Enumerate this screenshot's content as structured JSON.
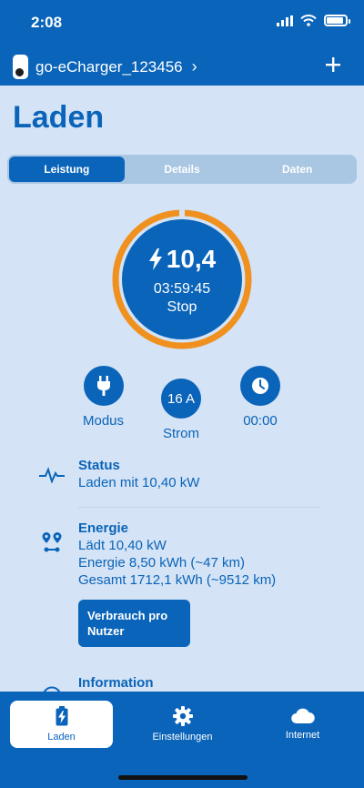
{
  "status_bar": {
    "time": "2:08"
  },
  "header": {
    "device_name": "go-eCharger_123456",
    "add_icon": "plus-icon"
  },
  "page": {
    "title": "Laden"
  },
  "tabs": [
    {
      "label": "Leistung",
      "active": true
    },
    {
      "label": "Details",
      "active": false
    },
    {
      "label": "Daten",
      "active": false
    }
  ],
  "gauge": {
    "power": "10,4",
    "elapsed": "03:59:45",
    "action": "Stop",
    "progress_color": "#f0901e",
    "fill_color": "#0a64b9"
  },
  "controls": [
    {
      "icon": "plug-icon",
      "value": "",
      "label": "Modus"
    },
    {
      "icon": "current-icon",
      "value": "16 A",
      "label": "Strom"
    },
    {
      "icon": "clock-icon",
      "value": "",
      "label": "00:00"
    }
  ],
  "status": {
    "title": "Status",
    "text": "Laden mit 10,40 kW"
  },
  "energy": {
    "title": "Energie",
    "lines": [
      "Lädt 10,40 kW",
      "Energie 8,50 kWh (~47 km)",
      "Gesamt 1712,1 kWh (~9512 km)"
    ],
    "button": "Verbrauch pro Nutzer"
  },
  "information": {
    "title": "Information"
  },
  "bottom_nav": [
    {
      "label": "Laden",
      "icon": "battery-charging-icon",
      "active": true
    },
    {
      "label": "Einstellungen",
      "icon": "gear-icon",
      "active": false
    },
    {
      "label": "Internet",
      "icon": "cloud-icon",
      "active": false
    }
  ],
  "colors": {
    "primary": "#0a64b9",
    "background": "#d4e3f5",
    "accent": "#f0901e"
  }
}
